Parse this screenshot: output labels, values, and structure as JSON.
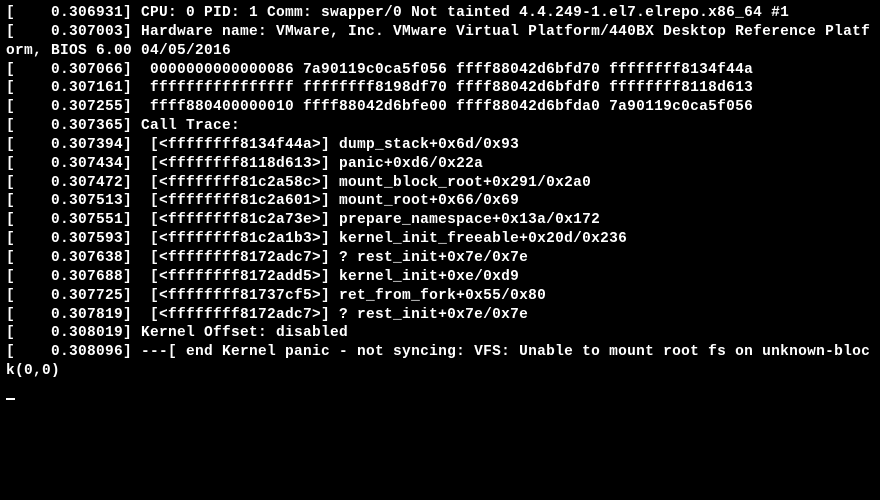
{
  "lines": [
    "[    0.306931] CPU: 0 PID: 1 Comm: swapper/0 Not tainted 4.4.249-1.el7.elrepo.x86_64 #1",
    "[    0.307003] Hardware name: VMware, Inc. VMware Virtual Platform/440BX Desktop Reference Platform, BIOS 6.00 04/05/2016",
    "[    0.307066]  0000000000000086 7a90119c0ca5f056 ffff88042d6bfd70 ffffffff8134f44a",
    "[    0.307161]  ffffffffffffffff ffffffff8198df70 ffff88042d6bfdf0 ffffffff8118d613",
    "[    0.307255]  ffff880400000010 ffff88042d6bfe00 ffff88042d6bfda0 7a90119c0ca5f056",
    "[    0.307365] Call Trace:",
    "[    0.307394]  [<ffffffff8134f44a>] dump_stack+0x6d/0x93",
    "[    0.307434]  [<ffffffff8118d613>] panic+0xd6/0x22a",
    "[    0.307472]  [<ffffffff81c2a58c>] mount_block_root+0x291/0x2a0",
    "[    0.307513]  [<ffffffff81c2a601>] mount_root+0x66/0x69",
    "[    0.307551]  [<ffffffff81c2a73e>] prepare_namespace+0x13a/0x172",
    "[    0.307593]  [<ffffffff81c2a1b3>] kernel_init_freeable+0x20d/0x236",
    "[    0.307638]  [<ffffffff8172adc7>] ? rest_init+0x7e/0x7e",
    "[    0.307688]  [<ffffffff8172add5>] kernel_init+0xe/0xd9",
    "[    0.307725]  [<ffffffff81737cf5>] ret_from_fork+0x55/0x80",
    "[    0.307819]  [<ffffffff8172adc7>] ? rest_init+0x7e/0x7e",
    "[    0.308019] Kernel Offset: disabled",
    "[    0.308096] ---[ end Kernel panic - not syncing: VFS: Unable to mount root fs on unknown-block(0,0)"
  ]
}
